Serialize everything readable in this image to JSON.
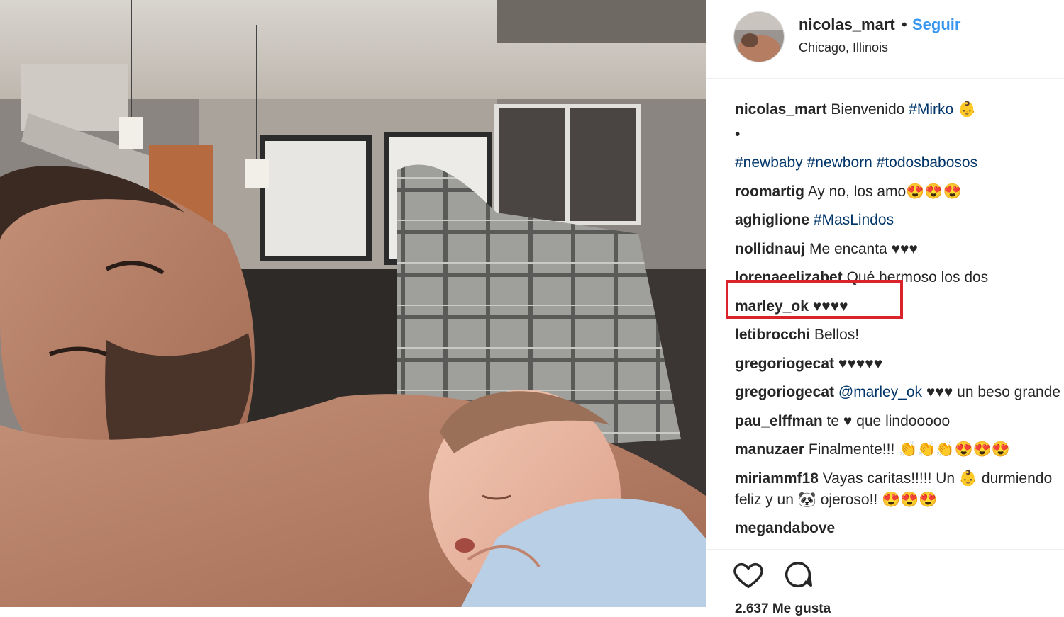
{
  "post": {
    "username": "nicolas_mart",
    "separator": "•",
    "follow_label": "Seguir",
    "location": "Chicago, Illinois"
  },
  "comments": [
    {
      "user": "nicolas_mart",
      "text": "Bienvenido ",
      "tag": "#Mirko",
      "suffix": " 👶"
    },
    {
      "user": "",
      "text": "•",
      "tag": "",
      "suffix": ""
    },
    {
      "user": "",
      "text": "",
      "tag": "#newbaby #newborn #todosbabosos",
      "suffix": ""
    },
    {
      "user": "roomartig",
      "text": "Ay no, los amo😍😍😍",
      "tag": "",
      "suffix": ""
    },
    {
      "user": "aghiglione",
      "text": "",
      "tag": "#MasLindos",
      "suffix": ""
    },
    {
      "user": "nollidnauj",
      "text": "Me encanta ♥♥♥",
      "tag": "",
      "suffix": ""
    },
    {
      "user": "lorenaeelizabet",
      "text": "Qué hermoso los dos",
      "tag": "",
      "suffix": ""
    },
    {
      "user": "marley_ok",
      "text": "♥♥♥♥",
      "tag": "",
      "suffix": ""
    },
    {
      "user": "letibrocchi",
      "text": "Bellos!",
      "tag": "",
      "suffix": ""
    },
    {
      "user": "gregoriogecat",
      "text": "♥♥♥♥♥",
      "tag": "",
      "suffix": ""
    },
    {
      "user": "gregoriogecat",
      "text": "",
      "tag": "@marley_ok",
      "suffix": " ♥♥♥ un beso grande"
    },
    {
      "user": "pau_elffman",
      "text": "te ♥ que lindooooo",
      "tag": "",
      "suffix": ""
    },
    {
      "user": "manuzaer",
      "text": "Finalmente!!! 👏👏👏😍😍😍",
      "tag": "",
      "suffix": ""
    },
    {
      "user": "miriammf18",
      "text": "Vayas caritas!!!!! Un 👶 durmiendo feliz y un 🐼 ojeroso!! 😍😍😍",
      "tag": "",
      "suffix": ""
    },
    {
      "user": "megandabove",
      "text": "",
      "tag": "",
      "suffix": ""
    }
  ],
  "actions": {
    "like_icon": "heart-icon",
    "comment_icon": "comment-bubble-icon",
    "likes_text": "2.637 Me gusta"
  },
  "highlight_color": "#d9242b",
  "link_color": "#003569",
  "follow_color": "#3897f0"
}
